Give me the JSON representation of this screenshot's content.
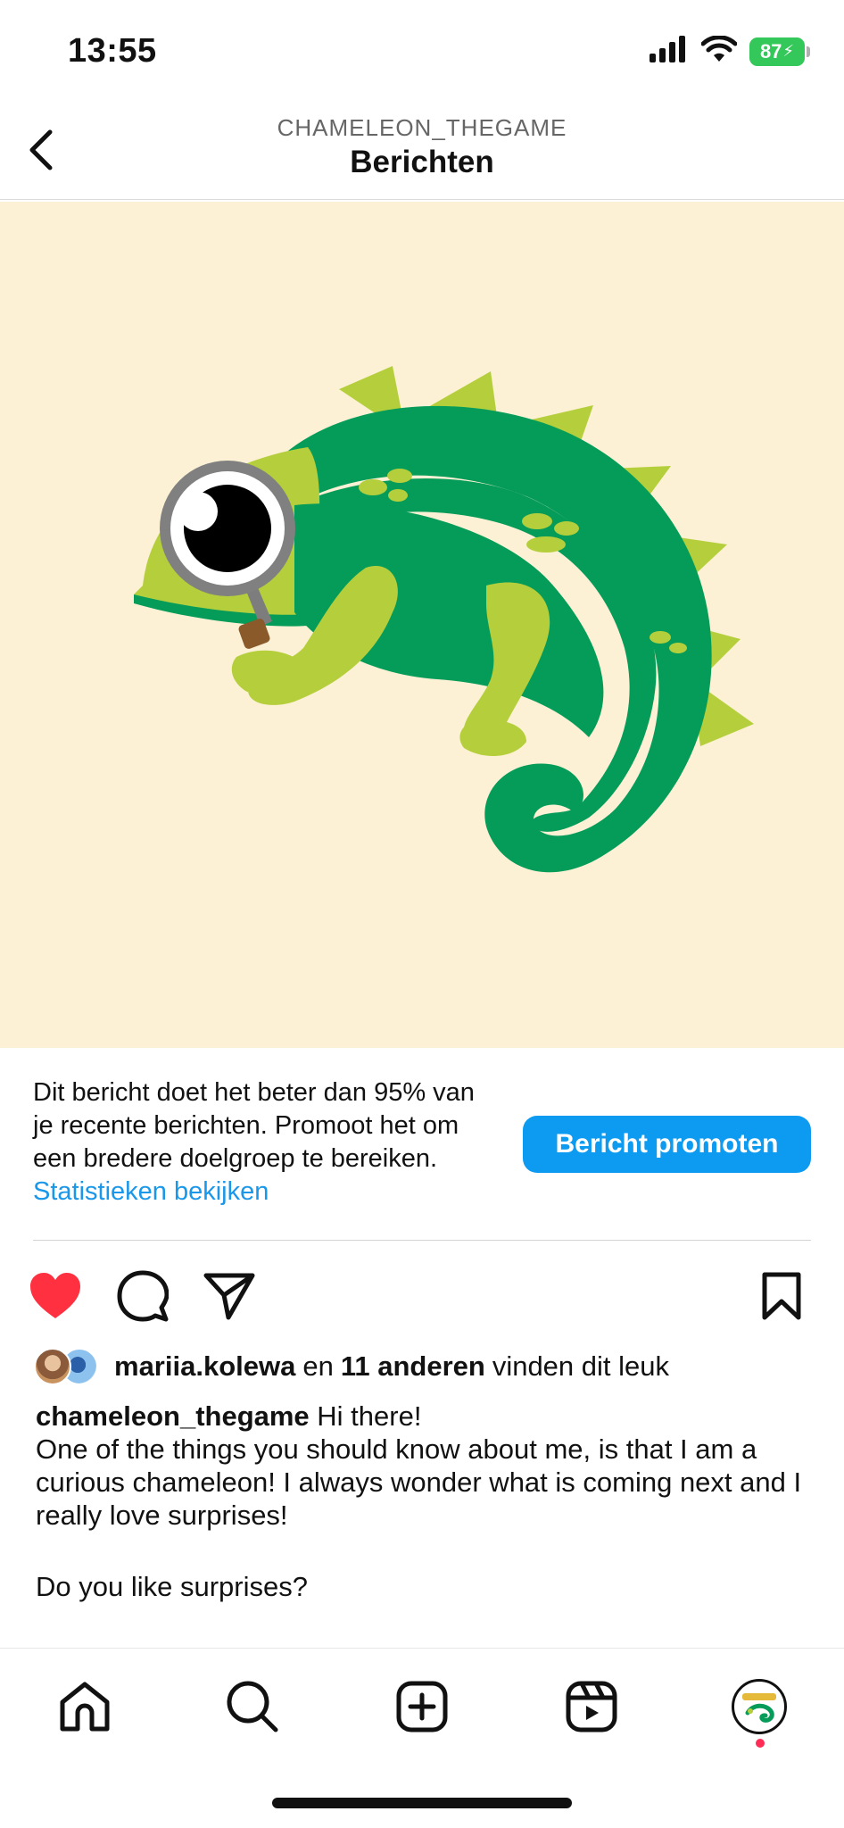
{
  "status_bar": {
    "time": "13:55",
    "battery": "87",
    "signal_icon": "signal-bars-icon",
    "wifi_icon": "wifi-icon",
    "battery_color": "#34c759"
  },
  "header": {
    "subtitle": "CHAMELEON_THEGAME",
    "title": "Berichten",
    "back_icon": "chevron-left-icon"
  },
  "post": {
    "background_color": "#fcf1d5",
    "image_description": "Cartoon green chameleon holding a magnifying glass over its eye"
  },
  "promote": {
    "text": "Dit bericht doet het beter dan 95% van je recente berichten. Promoot het om een bredere doelgroep te bereiken.",
    "link": "Statistieken bekijken",
    "button": "Bericht promoten",
    "accent_color": "#0d9af1"
  },
  "actions": {
    "like_icon": "heart-filled-icon",
    "comment_icon": "comment-icon",
    "share_icon": "send-icon",
    "save_icon": "bookmark-icon",
    "like_color": "#ff3040"
  },
  "likes": {
    "user": "mariia.kolewa",
    "connector": "en",
    "others": "11 anderen",
    "suffix": "vinden dit leuk"
  },
  "caption": {
    "username": "chameleon_thegame",
    "first_line": "Hi there!",
    "body": "One of the things you should know about me, is that I am a curious chameleon! I always wonder what is coming next and I really love surprises!",
    "question": "Do you like surprises?"
  },
  "bottom_nav": {
    "items": [
      "home-icon",
      "search-icon",
      "create-post-icon",
      "reels-icon",
      "profile-avatar"
    ],
    "notification_color": "#ff2d55"
  }
}
